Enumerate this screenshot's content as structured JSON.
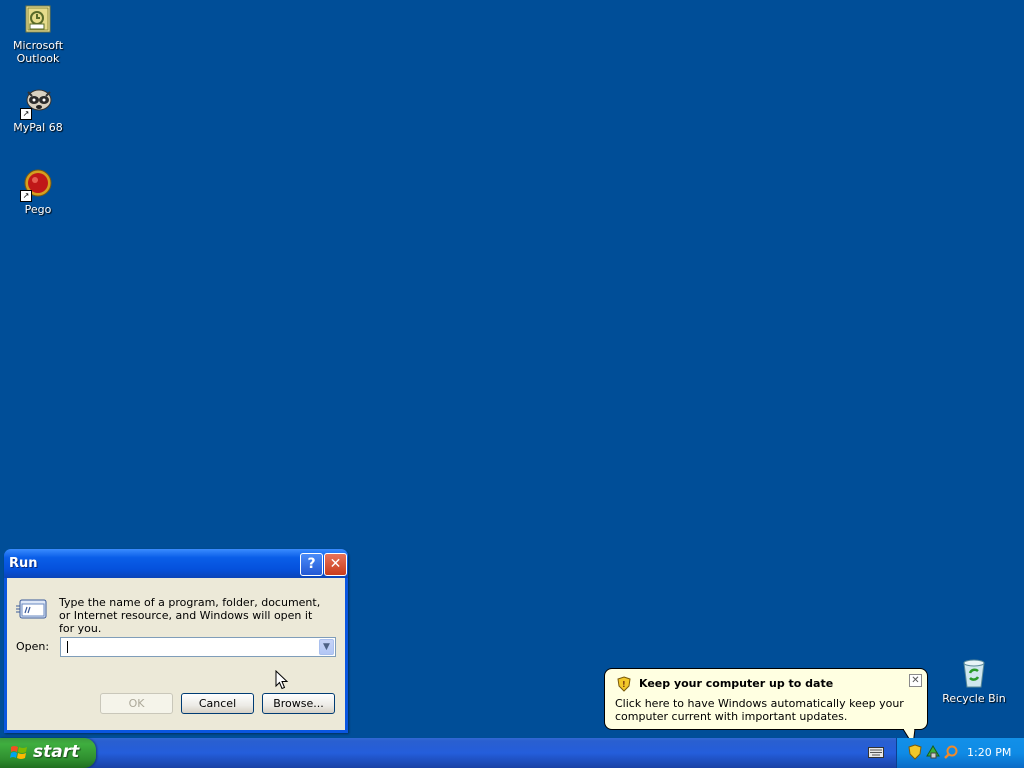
{
  "desktop": {
    "icons": [
      {
        "label_line1": "Microsoft",
        "label_line2": "Outlook"
      },
      {
        "label_line1": "MyPal 68"
      },
      {
        "label_line1": "Pego"
      }
    ],
    "recycle_bin": {
      "label": "Recycle Bin"
    }
  },
  "run_dialog": {
    "title": "Run",
    "help_glyph": "?",
    "close_glyph": "✕",
    "description": "Type the name of a program, folder, document, or Internet resource, and Windows will open it for you.",
    "open_label": "Open:",
    "open_value": "",
    "ok_label": "OK",
    "cancel_label": "Cancel",
    "browse_label": "Browse..."
  },
  "balloon": {
    "title": "Keep your computer up to date",
    "text": "Click here to have Windows automatically keep your computer current with important updates.",
    "close_glyph": "✕"
  },
  "taskbar": {
    "start_label": "start",
    "clock": "1:20 PM"
  },
  "colors": {
    "desktop": "#004e98",
    "dialog_face": "#ece9d8",
    "balloon": "#ffffe1"
  },
  "icons": [
    "outlook-icon",
    "mypal-icon",
    "pego-icon",
    "recycle-bin-icon",
    "run-icon",
    "shield-icon",
    "windows-flag-icon",
    "keyboard-icon",
    "update-shield-icon",
    "network-icon",
    "search-icon"
  ]
}
